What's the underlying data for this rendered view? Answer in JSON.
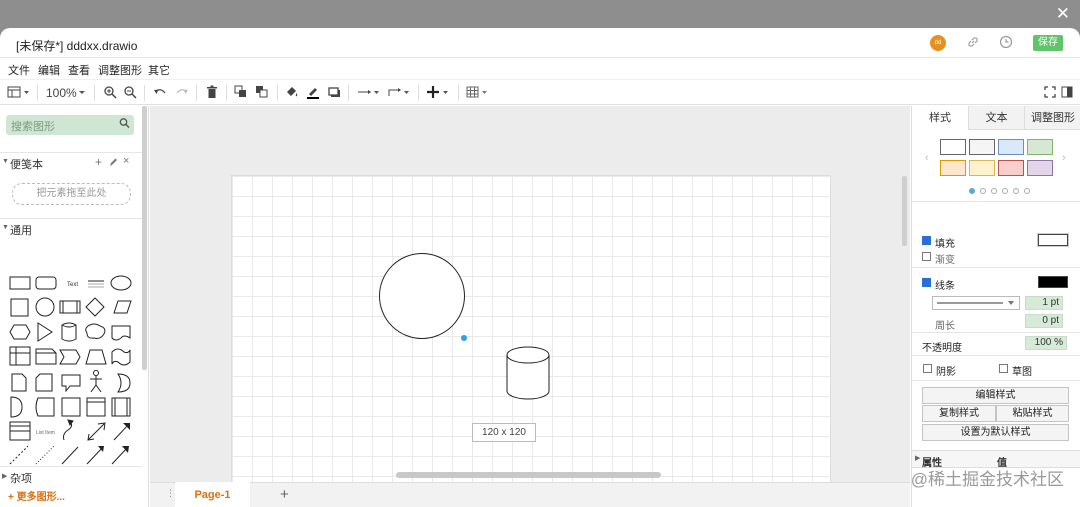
{
  "window": {
    "close_glyph": "✕",
    "title": "[未保存*]  dddxx.drawio",
    "save_label": "保存",
    "avatar_text": "dd"
  },
  "menu": [
    "文件",
    "编辑",
    "查看",
    "调整图形",
    "其它"
  ],
  "toolbar": {
    "zoom": "100%"
  },
  "left": {
    "search_placeholder": "搜索图形",
    "scratchpad_title": "便笺本",
    "dropzone_text": "把元素拖至此处",
    "general_title": "通用",
    "misc_title": "杂项",
    "more_shapes": "+ 更多图形..."
  },
  "canvas": {
    "size_tooltip": "120 x 120"
  },
  "pages": {
    "tab_label": "Page-1",
    "add_glyph": "+"
  },
  "right": {
    "tabs": [
      "样式",
      "文本",
      "调整图形"
    ],
    "swatches": [
      "#ffffff",
      "#f5f5f5",
      "#dae8fc",
      "#d5e8d4",
      "#ffe6cc",
      "#fff2cc",
      "#f8cecc",
      "#e1d5e7"
    ],
    "fill_label": "填充",
    "fill_color": "#ffffff",
    "gradient_label": "渐变",
    "line_label": "线条",
    "line_color": "#000000",
    "line_width": "1 pt",
    "perimeter_label": "周长",
    "perimeter_value": "0 pt",
    "opacity_label": "不透明度",
    "opacity_value": "100 %",
    "shadow_label": "阴影",
    "sketch_label": "草图",
    "edit_style": "编辑样式",
    "copy_style": "复制样式",
    "paste_style": "粘贴样式",
    "set_default": "设置为默认样式",
    "prop_col": "属性",
    "value_col": "值"
  },
  "watermark": "@稀土掘金技术社区"
}
